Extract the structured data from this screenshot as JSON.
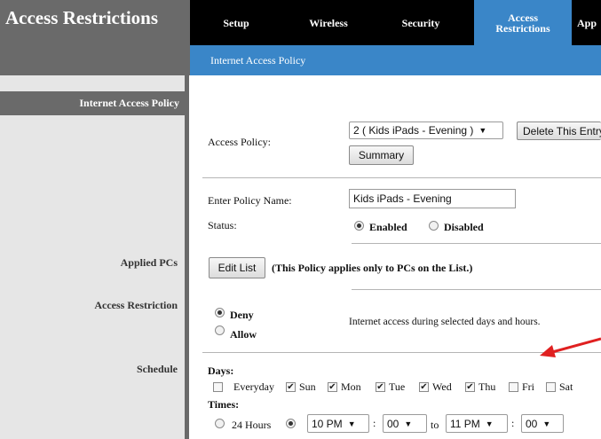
{
  "header": {
    "title": "Access Restrictions",
    "tabs": [
      {
        "label": "Setup"
      },
      {
        "label": "Wireless"
      },
      {
        "label": "Security"
      },
      {
        "label": "Access Restrictions",
        "active": true
      },
      {
        "label": "App"
      }
    ],
    "subnav": "Internet Access Policy"
  },
  "sidebar": {
    "section_title": "Internet Access Policy",
    "applied_pcs": "Applied PCs",
    "access_restriction": "Access Restriction",
    "schedule": "Schedule"
  },
  "policy": {
    "access_policy_label": "Access Policy:",
    "selected_policy": "2 ( Kids iPads - Evening )",
    "delete_button": "Delete This Entry",
    "summary_button": "Summary",
    "name_label": "Enter Policy Name:",
    "name_value": "Kids iPads - Evening",
    "status_label": "Status:",
    "enabled_label": "Enabled",
    "disabled_label": "Disabled",
    "status": "enabled"
  },
  "applied": {
    "edit_button": "Edit List",
    "note": "(This Policy applies only to PCs on the List.)"
  },
  "restriction": {
    "deny_label": "Deny",
    "allow_label": "Allow",
    "selected": "deny",
    "description": "Internet access during selected days and hours."
  },
  "schedule": {
    "days_label": "Days:",
    "days": [
      {
        "label": "Everyday",
        "checked": false
      },
      {
        "label": "Sun",
        "checked": true
      },
      {
        "label": "Mon",
        "checked": true
      },
      {
        "label": "Tue",
        "checked": true
      },
      {
        "label": "Wed",
        "checked": true
      },
      {
        "label": "Thu",
        "checked": true
      },
      {
        "label": "Fri",
        "checked": false
      },
      {
        "label": "Sat",
        "checked": false
      }
    ],
    "times_label": "Times:",
    "hours24_label": "24 Hours",
    "from_hour": "10 PM",
    "from_min": "00",
    "to_label": "to",
    "to_hour": "11 PM",
    "to_min": "00",
    "colon": ":"
  },
  "colors": {
    "header_gray": "#6a6a6a",
    "nav_black": "#000000",
    "active_tab_blue": "#3a86c8",
    "arrow_red": "#e02020"
  }
}
